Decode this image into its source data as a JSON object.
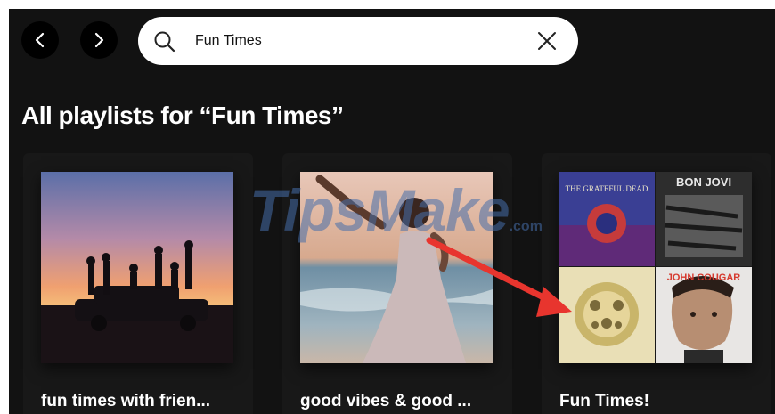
{
  "header": {
    "back_icon": "chevron-left-icon",
    "forward_icon": "chevron-right-icon",
    "search": {
      "value": "Fun Times",
      "icon": "search-icon",
      "clear_icon": "close-icon"
    }
  },
  "section": {
    "title": "All playlists for “Fun Times”"
  },
  "playlists": [
    {
      "title": "fun times with frien...",
      "cover": "sunset-friends-car"
    },
    {
      "title": "good vibes & good ...",
      "cover": "beach-dancer"
    },
    {
      "title": "Fun Times!",
      "cover": "album-mosaic"
    }
  ],
  "mosaic_labels": {
    "top_left": "THE GRATEFUL DEAD",
    "top_right": "BON JOVI",
    "bottom_right": "JOHN COUGAR"
  },
  "watermark": {
    "text": "TipsMake",
    "suffix": ".com"
  },
  "colors": {
    "background": "#121212",
    "card": "#181818",
    "arrow": "#e8352e"
  }
}
